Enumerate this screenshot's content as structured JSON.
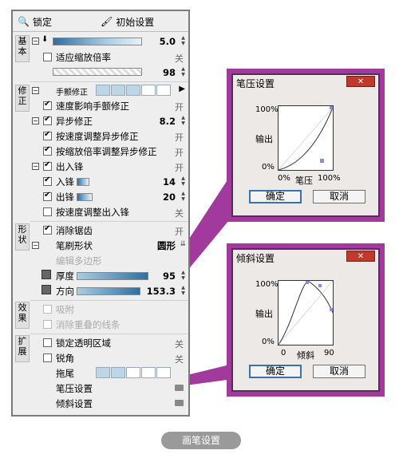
{
  "toolbar": {
    "lock": "锁定",
    "reset": "初始设置"
  },
  "tabs": {
    "basic": "基本",
    "correct": "修正",
    "shape": "形状",
    "effect": "效果",
    "extend": "扩展"
  },
  "basic": {
    "size_value": "5.0",
    "scale_label": "适应缩放倍率",
    "scale_state": "关",
    "opacity_value": "98"
  },
  "correct": {
    "hand_label": "手颤修正",
    "speed_label": "速度影响手颤修正",
    "speed_state": "开",
    "async_label": "异步修正",
    "async_value": "8.2",
    "async_speed_label": "按速度调整异步修正",
    "async_speed_state": "开",
    "async_zoom_label": "按缩放倍率调整异步修正",
    "async_zoom_state": "开",
    "inout_label": "出入锋",
    "inout_state": "开",
    "in_label": "入锋",
    "in_value": "14",
    "out_label": "出锋",
    "out_value": "20",
    "inout_speed_label": "按速度调整出入锋",
    "inout_speed_state": "关"
  },
  "shape": {
    "antialias_label": "消除锯齿",
    "antialias_state": "开",
    "tip_label": "笔刷形状",
    "tip_value": "圆形",
    "polygon_label": "编辑多边形",
    "thickness_label": "厚度",
    "thickness_value": "95",
    "direction_label": "方向",
    "direction_value": "153.3"
  },
  "effect": {
    "snap_label": "吸附",
    "dedupe_label": "消除重叠的线条"
  },
  "extend": {
    "lock_alpha_label": "锁定透明区域",
    "lock_alpha_state": "关",
    "sharp_label": "锐角",
    "sharp_state": "关",
    "trail_label": "拖尾",
    "pressure_label": "笔压设置",
    "tilt_label": "倾斜设置"
  },
  "pressure_dialog": {
    "title": "笔压设置",
    "y_top": "100%",
    "y_mid": "输出",
    "y_bottom": "0%",
    "x_left": "0%",
    "x_mid": "笔压",
    "x_right": "100%",
    "ok": "确定",
    "cancel": "取消"
  },
  "tilt_dialog": {
    "title": "倾斜设置",
    "y_top": "100%",
    "y_mid": "输出",
    "y_bottom": "0%",
    "x_left": "0",
    "x_mid": "倾斜",
    "x_right": "90",
    "ok": "确定",
    "cancel": "取消"
  },
  "caption": "画笔设置",
  "colors": {
    "accent": "#a23a9d",
    "bar": "#2f6f9f"
  }
}
